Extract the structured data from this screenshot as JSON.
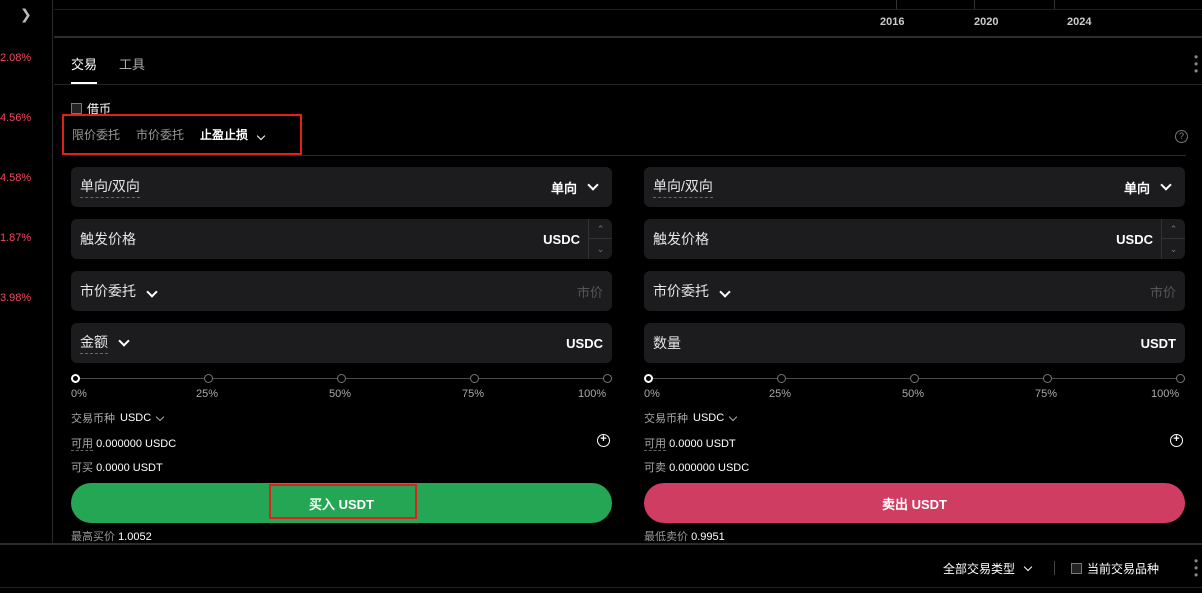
{
  "sidebar": {
    "expand_icon": "chevron-right-icon",
    "percents": [
      "2.08%",
      "4.56%",
      "4.58%",
      "1.87%",
      "3.98%"
    ]
  },
  "chart": {
    "years": [
      "2016",
      "2020",
      "2024"
    ]
  },
  "tabs": [
    {
      "label": "交易",
      "active": true
    },
    {
      "label": "工具",
      "active": false
    }
  ],
  "borrow_label": "借币",
  "order_types": [
    {
      "label": "限价委托",
      "active": false
    },
    {
      "label": "市价委托",
      "active": false
    },
    {
      "label": "止盈止损",
      "active": true
    }
  ],
  "buy": {
    "mode_label": "单向/双向",
    "mode_value": "单向",
    "trigger_label": "触发价格",
    "trigger_unit": "USDC",
    "order_type_label": "市价委托",
    "order_price_placeholder": "市价",
    "amount_label": "金额",
    "amount_unit": "USDC",
    "percents": [
      "0%",
      "25%",
      "50%",
      "75%",
      "100%"
    ],
    "slider_value": 0,
    "currency_label": "交易币种",
    "currency_value": "USDC",
    "available_label": "可用",
    "available_value": "0.000000 USDC",
    "can_label": "可买",
    "can_value": "0.0000 USDT",
    "action_label": "买入 USDT",
    "best_label": "最高买价",
    "best_value": "1.0052"
  },
  "sell": {
    "mode_label": "单向/双向",
    "mode_value": "单向",
    "trigger_label": "触发价格",
    "trigger_unit": "USDC",
    "order_type_label": "市价委托",
    "order_price_placeholder": "市价",
    "amount_label": "数量",
    "amount_unit": "USDT",
    "percents": [
      "0%",
      "25%",
      "50%",
      "75%",
      "100%"
    ],
    "slider_value": 0,
    "currency_label": "交易币种",
    "currency_value": "USDC",
    "available_label": "可用",
    "available_value": "0.0000 USDT",
    "can_label": "可卖",
    "can_value": "0.000000 USDC",
    "action_label": "卖出 USDT",
    "best_label": "最低卖价",
    "best_value": "0.9951"
  },
  "bottom": {
    "filter_label": "全部交易类型",
    "current_only_label": "当前交易品种"
  },
  "colors": {
    "buy": "#24a655",
    "sell": "#cf3d62",
    "highlight": "#e0201c",
    "negative": "#f6465d"
  }
}
